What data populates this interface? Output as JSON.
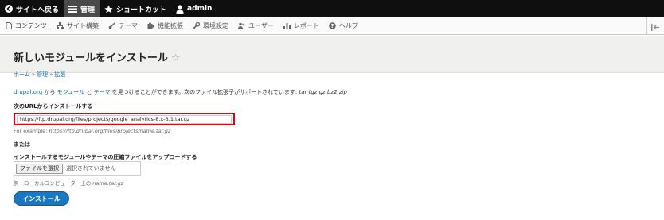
{
  "toolbar": {
    "back_label": "サイトへ戻る",
    "manage_label": "管理",
    "shortcuts_label": "ショートカット",
    "user_label": "admin"
  },
  "tray": {
    "items": [
      "コンテンツ",
      "サイト構築",
      "テーマ",
      "機能拡張",
      "環境設定",
      "ユーザー",
      "レポート",
      "ヘルプ"
    ]
  },
  "page": {
    "title": "新しいモジュールをインストール",
    "star": "☆"
  },
  "breadcrumb": {
    "home": "ホーム",
    "admin": "管理",
    "extend": "拡張",
    "sep": "»"
  },
  "intro": {
    "site_link": "drupal.org",
    "text1": " から ",
    "modules_link": "モジュール",
    "text2": " と ",
    "themes_link": "テーマ",
    "text3": " を見つけることができます。次のファイル拡張子がサポートされています: ",
    "extensions": "tar tgz gz bz2 zip"
  },
  "form": {
    "url_label": "次のURLからインストールする",
    "url_value": "https://ftp.drupal.org/files/projects/google_analytics-8.x-3.1.tar.gz",
    "url_hint_prefix": "For example: ",
    "url_hint_example": "https://ftp.drupal.org/files/projects/name.tar.gz",
    "or_label": "または",
    "upload_label": "インストールするモジュールやテーマの圧縮ファイルをアップロードする",
    "file_button": "ファイルを選択",
    "file_status": "選択されていません",
    "upload_hint_prefix": "例 : ローカルコンピューター上の ",
    "upload_hint_example": "name.tar.gz",
    "submit": "インストール"
  },
  "colors": {
    "link": "#0074bd",
    "highlight": "#e2001a",
    "button": "#1a78c2"
  }
}
